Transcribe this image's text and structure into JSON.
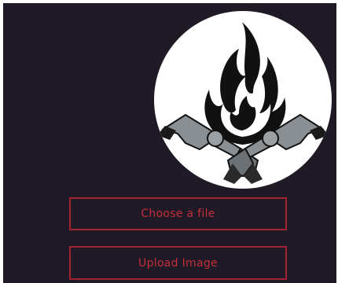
{
  "profile": {
    "image": "crossed-revolvers-flame-icon"
  },
  "actions": {
    "choose_label": "Choose a file",
    "upload_label": "Upload Image"
  },
  "colors": {
    "background": "#1f1a25",
    "accent": "#a12232",
    "accent_text": "#c42e3c",
    "avatar_bg": "#ffffff"
  }
}
